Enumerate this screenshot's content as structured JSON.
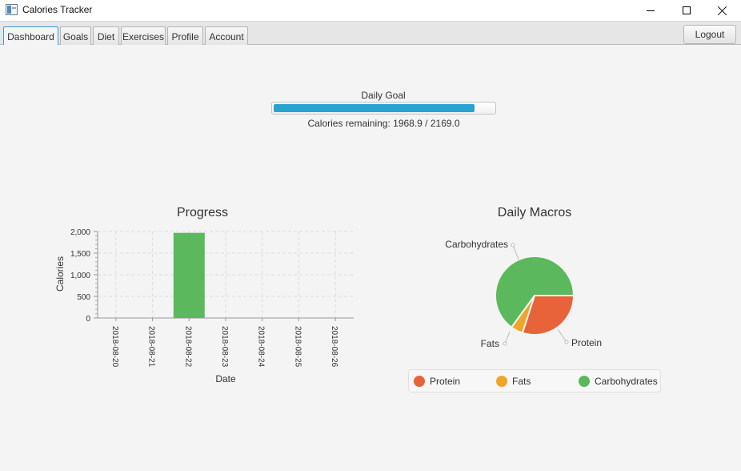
{
  "window": {
    "title": "Calories Tracker"
  },
  "tabs": [
    {
      "label": "Dashboard",
      "active": true
    },
    {
      "label": "Goals"
    },
    {
      "label": "Diet"
    },
    {
      "label": "Exercises"
    },
    {
      "label": "Profile"
    },
    {
      "label": "Account"
    }
  ],
  "logout_label": "Logout",
  "daily_goal": {
    "label": "Daily Goal",
    "progress": 0.9078,
    "remaining_text": "Calories remaining: 1968.9 / 2169.0",
    "bar_color": "#29a3d0"
  },
  "chart_data": [
    {
      "type": "bar",
      "title": "Progress",
      "xlabel": "Date",
      "ylabel": "Calories",
      "categories": [
        "2018-08-20",
        "2018-08-21",
        "2018-08-22",
        "2018-08-23",
        "2018-08-24",
        "2018-08-25",
        "2018-08-26"
      ],
      "values": [
        0,
        0,
        1969,
        0,
        0,
        0,
        0
      ],
      "yticks": [
        "0",
        "500",
        "1,000",
        "1,500",
        "2,000"
      ],
      "ylim": [
        0,
        2000
      ],
      "grid": true,
      "bar_color": "#5cb85c"
    },
    {
      "type": "pie",
      "title": "Daily Macros",
      "slices": [
        {
          "label": "Protein",
          "value": 30,
          "color": "#e8633a"
        },
        {
          "label": "Fats",
          "value": 5,
          "color": "#efa52a"
        },
        {
          "label": "Carbohydrates",
          "value": 65,
          "color": "#5cb85c"
        }
      ],
      "legend": "bottom"
    }
  ]
}
